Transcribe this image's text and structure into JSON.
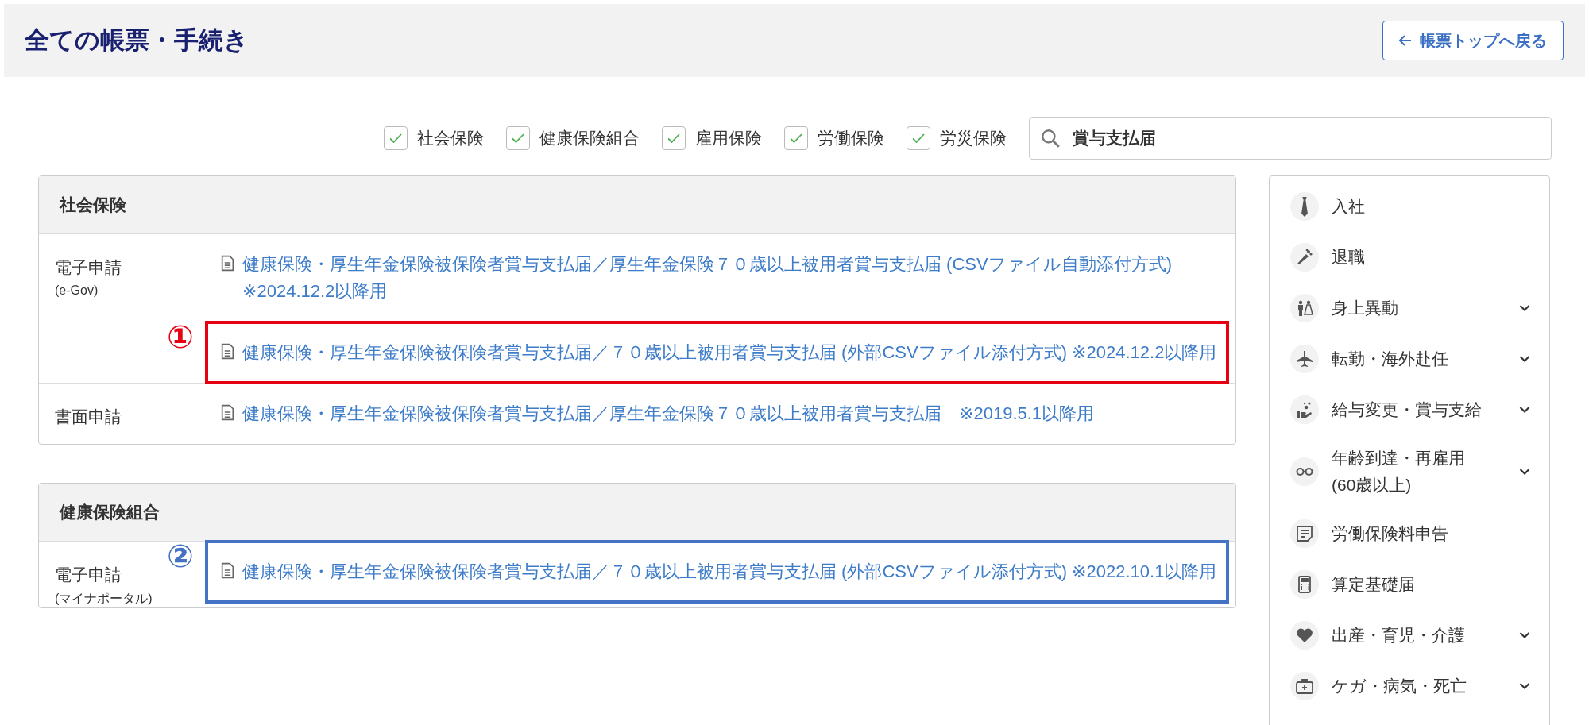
{
  "title": "全ての帳票・手続き",
  "back_button": {
    "label": "帳票トップへ戻る"
  },
  "filters": [
    {
      "label": "社会保険",
      "checked": true
    },
    {
      "label": "健康保険組合",
      "checked": true
    },
    {
      "label": "雇用保険",
      "checked": true
    },
    {
      "label": "労働保険",
      "checked": true
    },
    {
      "label": "労災保険",
      "checked": true
    }
  ],
  "search": {
    "value": "賞与支払届"
  },
  "sections": [
    {
      "title": "社会保険",
      "rows": [
        {
          "method": "電子申請",
          "method_sub": "(e-Gov)",
          "links": [
            {
              "text": "健康保険・厚生年金保険被保険者賞与支払届／厚生年金保険７０歳以上被用者賞与支払届 (CSVファイル自動添付方式) ※2024.12.2以降用"
            },
            {
              "text": "健康保険・厚生年金保険被保険者賞与支払届／７０歳以上被用者賞与支払届 (外部CSVファイル添付方式) ※2024.12.2以降用",
              "annotation": {
                "number": "①",
                "color": "#e60012"
              }
            }
          ]
        },
        {
          "method": "書面申請",
          "links": [
            {
              "text": "健康保険・厚生年金保険被保険者賞与支払届／厚生年金保険７０歳以上被用者賞与支払届　※2019.5.1以降用"
            }
          ]
        }
      ]
    },
    {
      "title": "健康保険組合",
      "rows": [
        {
          "method": "電子申請",
          "method_sub": "(マイナポータル)",
          "links": [
            {
              "text": "健康保険・厚生年金保険被保険者賞与支払届／７０歳以上被用者賞与支払届 (外部CSVファイル添付方式) ※2022.10.1以降用",
              "annotation": {
                "number": "②",
                "color": "#4472c4"
              }
            }
          ]
        }
      ]
    }
  ],
  "sidebar": [
    {
      "label": "入社",
      "expandable": false
    },
    {
      "label": "退職",
      "expandable": false
    },
    {
      "label": "身上異動",
      "expandable": true
    },
    {
      "label": "転勤・海外赴任",
      "expandable": true
    },
    {
      "label": "給与変更・賞与支給",
      "expandable": true
    },
    {
      "label": "年齢到達・再雇用\n(60歳以上)",
      "expandable": true
    },
    {
      "label": "労働保険料申告",
      "expandable": false
    },
    {
      "label": "算定基礎届",
      "expandable": false
    },
    {
      "label": "出産・育児・介護",
      "expandable": true
    },
    {
      "label": "ケガ・病気・死亡",
      "expandable": true
    }
  ]
}
